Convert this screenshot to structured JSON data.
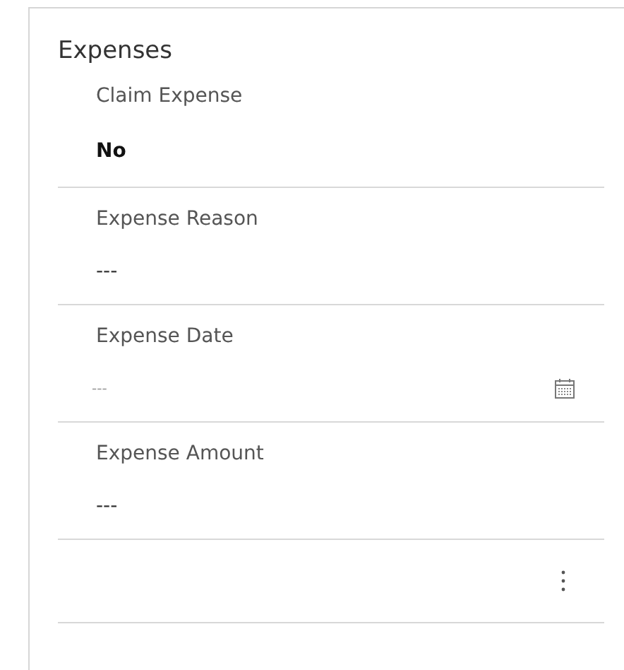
{
  "section": {
    "title": "Expenses",
    "fields": [
      {
        "kind": "choice",
        "label": "Claim Expense",
        "value": "No"
      },
      {
        "kind": "text",
        "label": "Expense Reason",
        "value": "---"
      },
      {
        "kind": "date",
        "label": "Expense Date",
        "placeholder": "---"
      },
      {
        "kind": "text",
        "label": "Expense Amount",
        "value": "---"
      }
    ],
    "more_menu": true
  }
}
